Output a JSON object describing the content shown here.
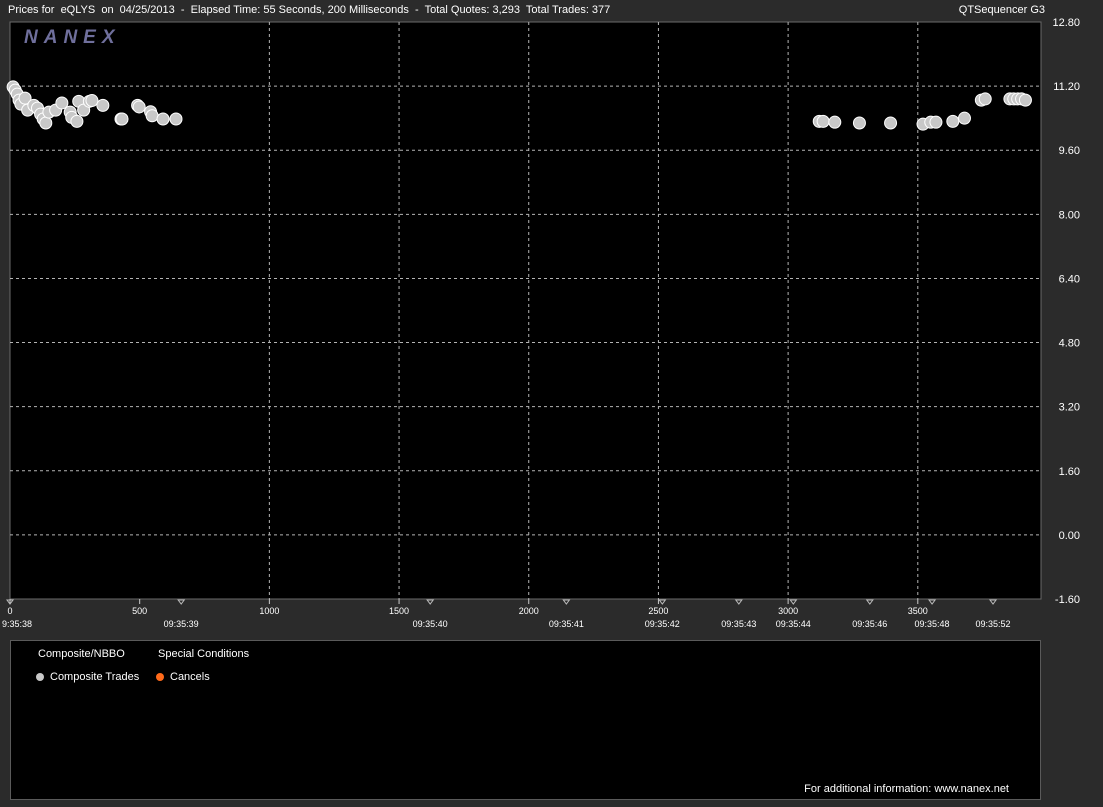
{
  "header": {
    "title": "Prices for  eQLYS  on  04/25/2013  -  Elapsed Time: 55 Seconds, 200 Milliseconds  -  Total Quotes: 3,293  Total Trades: 377",
    "app_name": "QTSequencer G3"
  },
  "watermark": "NANEX",
  "legend": {
    "group1_title": "Composite/NBBO",
    "group2_title": "Special Conditions",
    "items": [
      {
        "label": "Composite Trades",
        "color": "#c8c8c8"
      },
      {
        "label": "Cancels",
        "color": "#ff6a1a"
      }
    ]
  },
  "footer": "For additional information: www.nanex.net",
  "colors": {
    "background": "#000000",
    "frame": "#2b2b2b",
    "grid": "#b4b4b4",
    "trade": "#c8c8c8"
  },
  "chart_data": {
    "type": "scatter",
    "xlim": [
      0,
      3975
    ],
    "ylim": [
      -1.6,
      12.8
    ],
    "y_ticks": [
      12.8,
      11.2,
      9.6,
      8.0,
      6.4,
      4.8,
      3.2,
      1.6,
      0.0,
      -1.6
    ],
    "y_tick_labels": [
      "12.80",
      "11.20",
      "9.60",
      "8.00",
      "6.40",
      "4.80",
      "3.20",
      "1.60",
      "0.00",
      "-1.60"
    ],
    "x_ticks": [
      0,
      500,
      1000,
      1500,
      2000,
      2500,
      3000,
      3500
    ],
    "x_tick_labels": [
      "0",
      "500",
      "1000",
      "1500",
      "2000",
      "2500",
      "3000",
      "3500"
    ],
    "x_vgrid": [
      1000,
      1500,
      2000,
      2500,
      3000,
      3500
    ],
    "time_labels": [
      {
        "x": 0,
        "label": "9:35:38"
      },
      {
        "x": 660,
        "label": "09:35:39"
      },
      {
        "x": 1620,
        "label": "09:35:40"
      },
      {
        "x": 2145,
        "label": "09:35:41"
      },
      {
        "x": 2515,
        "label": "09:35:42"
      },
      {
        "x": 2810,
        "label": "09:35:43"
      },
      {
        "x": 3020,
        "label": "09:35:44"
      },
      {
        "x": 3315,
        "label": "09:35:46"
      },
      {
        "x": 3555,
        "label": "09:35:48"
      },
      {
        "x": 3790,
        "label": "09:35:52"
      }
    ],
    "grid": true,
    "legend_position": "bottom-left",
    "series": [
      {
        "name": "Composite Trades",
        "x": [
          12,
          20,
          28,
          35,
          42,
          58,
          68,
          92,
          106,
          118,
          128,
          138,
          150,
          176,
          200,
          232,
          238,
          258,
          265,
          284,
          306,
          316,
          358,
          428,
          432,
          492,
          498,
          542,
          548,
          590,
          640,
          3120,
          3135,
          3180,
          3275,
          3395,
          3520,
          3550,
          3570,
          3635,
          3680,
          3745,
          3760,
          3855,
          3870,
          3885,
          3900,
          3915
        ],
        "y": [
          11.18,
          11.1,
          11.0,
          10.85,
          10.75,
          10.9,
          10.6,
          10.72,
          10.65,
          10.5,
          10.38,
          10.28,
          10.55,
          10.6,
          10.78,
          10.55,
          10.42,
          10.32,
          10.82,
          10.6,
          10.82,
          10.84,
          10.72,
          10.38,
          10.38,
          10.72,
          10.68,
          10.56,
          10.46,
          10.38,
          10.38,
          10.32,
          10.32,
          10.3,
          10.28,
          10.28,
          10.25,
          10.3,
          10.3,
          10.32,
          10.4,
          10.85,
          10.88,
          10.88,
          10.88,
          10.88,
          10.88,
          10.85
        ]
      },
      {
        "name": "Cancels",
        "x": [],
        "y": []
      }
    ]
  }
}
